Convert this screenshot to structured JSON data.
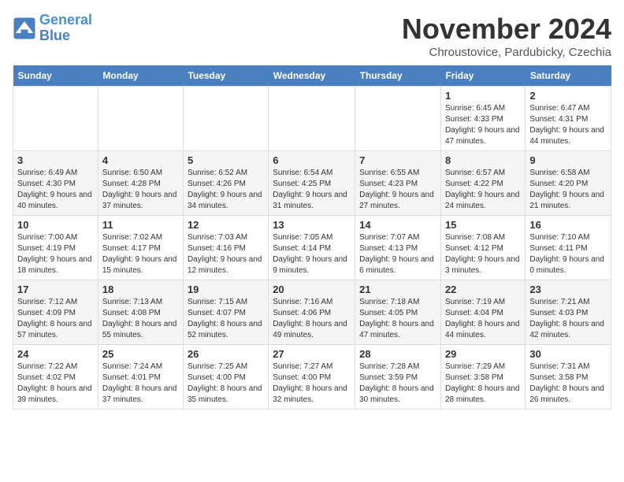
{
  "header": {
    "logo_line1": "General",
    "logo_line2": "Blue",
    "month": "November 2024",
    "location": "Chroustovice, Pardubicky, Czechia"
  },
  "days_of_week": [
    "Sunday",
    "Monday",
    "Tuesday",
    "Wednesday",
    "Thursday",
    "Friday",
    "Saturday"
  ],
  "weeks": [
    [
      {
        "day": "",
        "info": ""
      },
      {
        "day": "",
        "info": ""
      },
      {
        "day": "",
        "info": ""
      },
      {
        "day": "",
        "info": ""
      },
      {
        "day": "",
        "info": ""
      },
      {
        "day": "1",
        "info": "Sunrise: 6:45 AM\nSunset: 4:33 PM\nDaylight: 9 hours and 47 minutes."
      },
      {
        "day": "2",
        "info": "Sunrise: 6:47 AM\nSunset: 4:31 PM\nDaylight: 9 hours and 44 minutes."
      }
    ],
    [
      {
        "day": "3",
        "info": "Sunrise: 6:49 AM\nSunset: 4:30 PM\nDaylight: 9 hours and 40 minutes."
      },
      {
        "day": "4",
        "info": "Sunrise: 6:50 AM\nSunset: 4:28 PM\nDaylight: 9 hours and 37 minutes."
      },
      {
        "day": "5",
        "info": "Sunrise: 6:52 AM\nSunset: 4:26 PM\nDaylight: 9 hours and 34 minutes."
      },
      {
        "day": "6",
        "info": "Sunrise: 6:54 AM\nSunset: 4:25 PM\nDaylight: 9 hours and 31 minutes."
      },
      {
        "day": "7",
        "info": "Sunrise: 6:55 AM\nSunset: 4:23 PM\nDaylight: 9 hours and 27 minutes."
      },
      {
        "day": "8",
        "info": "Sunrise: 6:57 AM\nSunset: 4:22 PM\nDaylight: 9 hours and 24 minutes."
      },
      {
        "day": "9",
        "info": "Sunrise: 6:58 AM\nSunset: 4:20 PM\nDaylight: 9 hours and 21 minutes."
      }
    ],
    [
      {
        "day": "10",
        "info": "Sunrise: 7:00 AM\nSunset: 4:19 PM\nDaylight: 9 hours and 18 minutes."
      },
      {
        "day": "11",
        "info": "Sunrise: 7:02 AM\nSunset: 4:17 PM\nDaylight: 9 hours and 15 minutes."
      },
      {
        "day": "12",
        "info": "Sunrise: 7:03 AM\nSunset: 4:16 PM\nDaylight: 9 hours and 12 minutes."
      },
      {
        "day": "13",
        "info": "Sunrise: 7:05 AM\nSunset: 4:14 PM\nDaylight: 9 hours and 9 minutes."
      },
      {
        "day": "14",
        "info": "Sunrise: 7:07 AM\nSunset: 4:13 PM\nDaylight: 9 hours and 6 minutes."
      },
      {
        "day": "15",
        "info": "Sunrise: 7:08 AM\nSunset: 4:12 PM\nDaylight: 9 hours and 3 minutes."
      },
      {
        "day": "16",
        "info": "Sunrise: 7:10 AM\nSunset: 4:11 PM\nDaylight: 9 hours and 0 minutes."
      }
    ],
    [
      {
        "day": "17",
        "info": "Sunrise: 7:12 AM\nSunset: 4:09 PM\nDaylight: 8 hours and 57 minutes."
      },
      {
        "day": "18",
        "info": "Sunrise: 7:13 AM\nSunset: 4:08 PM\nDaylight: 8 hours and 55 minutes."
      },
      {
        "day": "19",
        "info": "Sunrise: 7:15 AM\nSunset: 4:07 PM\nDaylight: 8 hours and 52 minutes."
      },
      {
        "day": "20",
        "info": "Sunrise: 7:16 AM\nSunset: 4:06 PM\nDaylight: 8 hours and 49 minutes."
      },
      {
        "day": "21",
        "info": "Sunrise: 7:18 AM\nSunset: 4:05 PM\nDaylight: 8 hours and 47 minutes."
      },
      {
        "day": "22",
        "info": "Sunrise: 7:19 AM\nSunset: 4:04 PM\nDaylight: 8 hours and 44 minutes."
      },
      {
        "day": "23",
        "info": "Sunrise: 7:21 AM\nSunset: 4:03 PM\nDaylight: 8 hours and 42 minutes."
      }
    ],
    [
      {
        "day": "24",
        "info": "Sunrise: 7:22 AM\nSunset: 4:02 PM\nDaylight: 8 hours and 39 minutes."
      },
      {
        "day": "25",
        "info": "Sunrise: 7:24 AM\nSunset: 4:01 PM\nDaylight: 8 hours and 37 minutes."
      },
      {
        "day": "26",
        "info": "Sunrise: 7:25 AM\nSunset: 4:00 PM\nDaylight: 8 hours and 35 minutes."
      },
      {
        "day": "27",
        "info": "Sunrise: 7:27 AM\nSunset: 4:00 PM\nDaylight: 8 hours and 32 minutes."
      },
      {
        "day": "28",
        "info": "Sunrise: 7:28 AM\nSunset: 3:59 PM\nDaylight: 8 hours and 30 minutes."
      },
      {
        "day": "29",
        "info": "Sunrise: 7:29 AM\nSunset: 3:58 PM\nDaylight: 8 hours and 28 minutes."
      },
      {
        "day": "30",
        "info": "Sunrise: 7:31 AM\nSunset: 3:58 PM\nDaylight: 8 hours and 26 minutes."
      }
    ]
  ]
}
